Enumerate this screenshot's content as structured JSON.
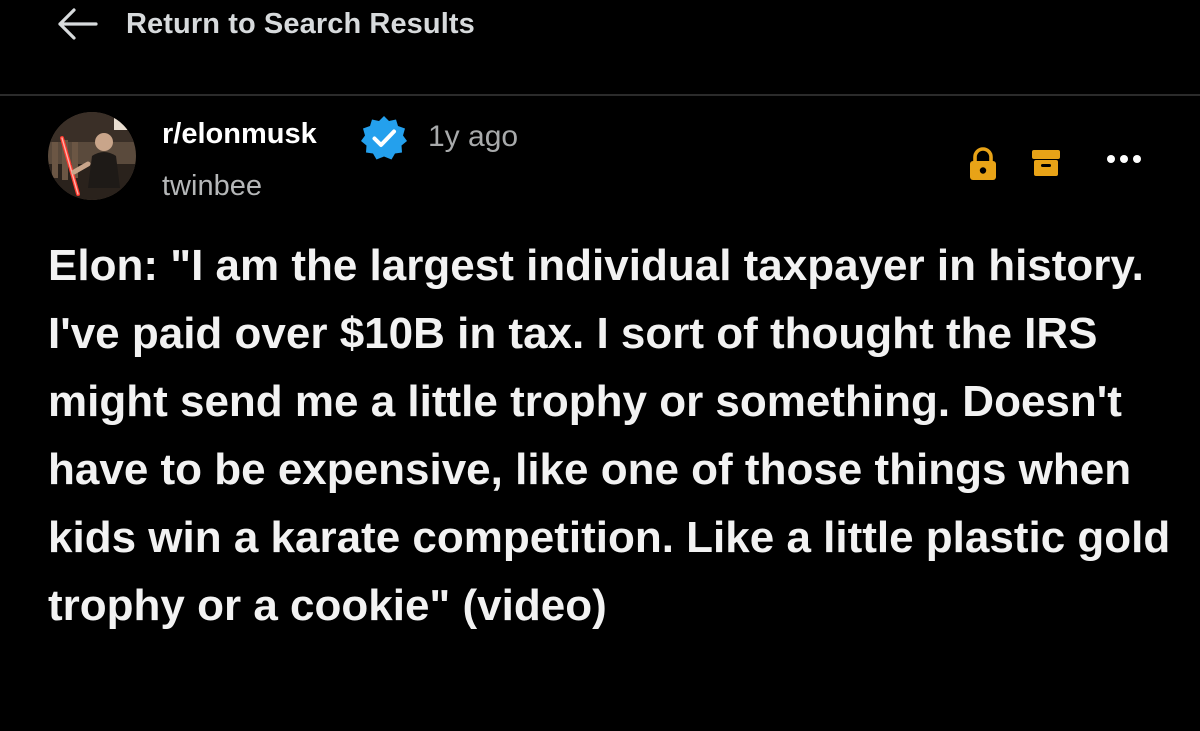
{
  "nav": {
    "back_label": "Return to Search Results"
  },
  "post": {
    "subreddit": "r/elonmusk",
    "age": "1y ago",
    "author": "twinbee",
    "title": "Elon: \"I am the largest individual taxpayer in history. I've paid over $10B in tax. I sort of thought the IRS might send me a little trophy or something. Doesn't have to be expensive, like one of those things when kids win a karate competition. Like a little plastic gold trophy or a cookie\" (video)"
  },
  "icons": {
    "back": "arrow-left-icon",
    "verified": "verified-badge-icon",
    "lock": "lock-icon",
    "archive": "archive-icon",
    "more": "more-options-icon"
  },
  "colors": {
    "background": "#000000",
    "verified_badge": "#24a0ed",
    "moderator_icons": "#e8a317",
    "divider": "#2b2b2b"
  }
}
